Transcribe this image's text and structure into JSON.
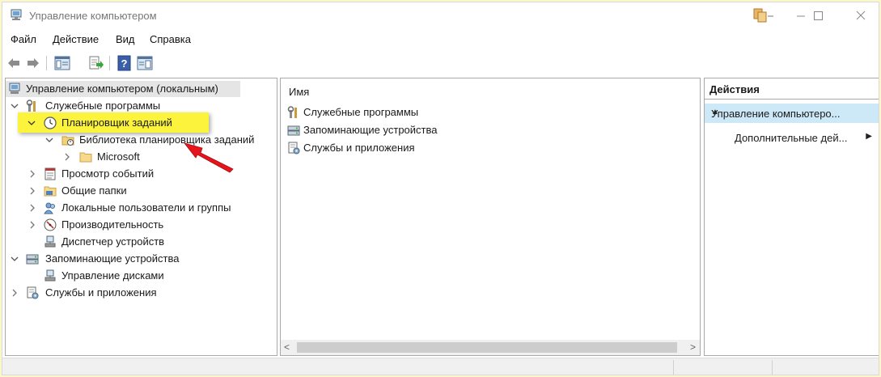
{
  "window": {
    "title": "Управление компьютером"
  },
  "menu": {
    "items": [
      "Файл",
      "Действие",
      "Вид",
      "Справка"
    ]
  },
  "toolbar": {
    "icons": [
      "back-arrow-icon",
      "forward-arrow-icon",
      "show-hide-console-tree-icon",
      "export-list-icon",
      "help-icon",
      "show-hide-action-pane-icon"
    ]
  },
  "tree": {
    "root": "Управление компьютером (локальным)",
    "system_tools": "Служебные программы",
    "task_scheduler": "Планировщик заданий",
    "task_scheduler_library": "Библиотека планировщика заданий",
    "microsoft": "Microsoft",
    "event_viewer": "Просмотр событий",
    "shared_folders": "Общие папки",
    "local_users": "Локальные пользователи и группы",
    "performance": "Производительность",
    "device_manager": "Диспетчер устройств",
    "storage": "Запоминающие устройства",
    "disk_management": "Управление дисками",
    "services_apps": "Службы и приложения"
  },
  "list": {
    "column_name": "Имя",
    "rows": [
      "Служебные программы",
      "Запоминающие устройства",
      "Службы и приложения"
    ]
  },
  "actions": {
    "header": "Действия",
    "group": "Управление компьютеро...",
    "more": "Дополнительные дей..."
  },
  "colors": {
    "highlight": "#fbf33c",
    "selection": "#cde8f7",
    "arrow": "#e8141c",
    "background": "#fbf6cc"
  }
}
